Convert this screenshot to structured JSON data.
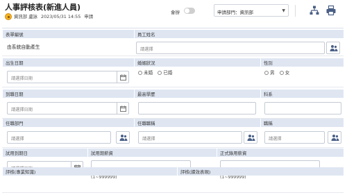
{
  "header": {
    "title": "人事評核表(新進人員)",
    "author": "資訊部 盧詠",
    "datetime": "2023/05/31 14:55",
    "action": "申請",
    "attach_label": "會辦",
    "attach_enabled": false,
    "dept_select": "申請部門：資訊部",
    "icons": [
      "org-chart-icon",
      "print-icon"
    ]
  },
  "form": {
    "form_no": {
      "label": "表單編號",
      "value": "由系統自動產生"
    },
    "employee_name": {
      "label": "員工姓名",
      "placeholder": "請選擇"
    },
    "birth_date": {
      "label": "出生日期",
      "placeholder": "請選擇日期"
    },
    "marital": {
      "label": "婚姻狀況",
      "options": [
        "未婚",
        "已婚"
      ]
    },
    "gender": {
      "label": "性別",
      "options": [
        "男",
        "女"
      ]
    },
    "hire_date": {
      "label": "到職日期",
      "placeholder": "請選擇日期"
    },
    "education": {
      "label": "最高學歷",
      "placeholder": ""
    },
    "department": {
      "label": "科系",
      "placeholder": ""
    },
    "assigned_dept": {
      "label": "任職部門",
      "placeholder": "請選擇"
    },
    "assigned_title": {
      "label": "任職職稱",
      "placeholder": "請選擇"
    },
    "rank": {
      "label": "職稱",
      "placeholder": "請選擇"
    },
    "probation_end": {
      "label": "試用到期日",
      "placeholder": "請選擇日期"
    },
    "probation_salary": {
      "label": "試用期薪資",
      "hint": "(1~999999)"
    },
    "regular_salary": {
      "label": "正式錄用薪資",
      "hint": "(1~999999)"
    },
    "eval_professional": {
      "label": "評核(專業知識)"
    },
    "eval_performance": {
      "label": "評核(績效表現)"
    }
  }
}
